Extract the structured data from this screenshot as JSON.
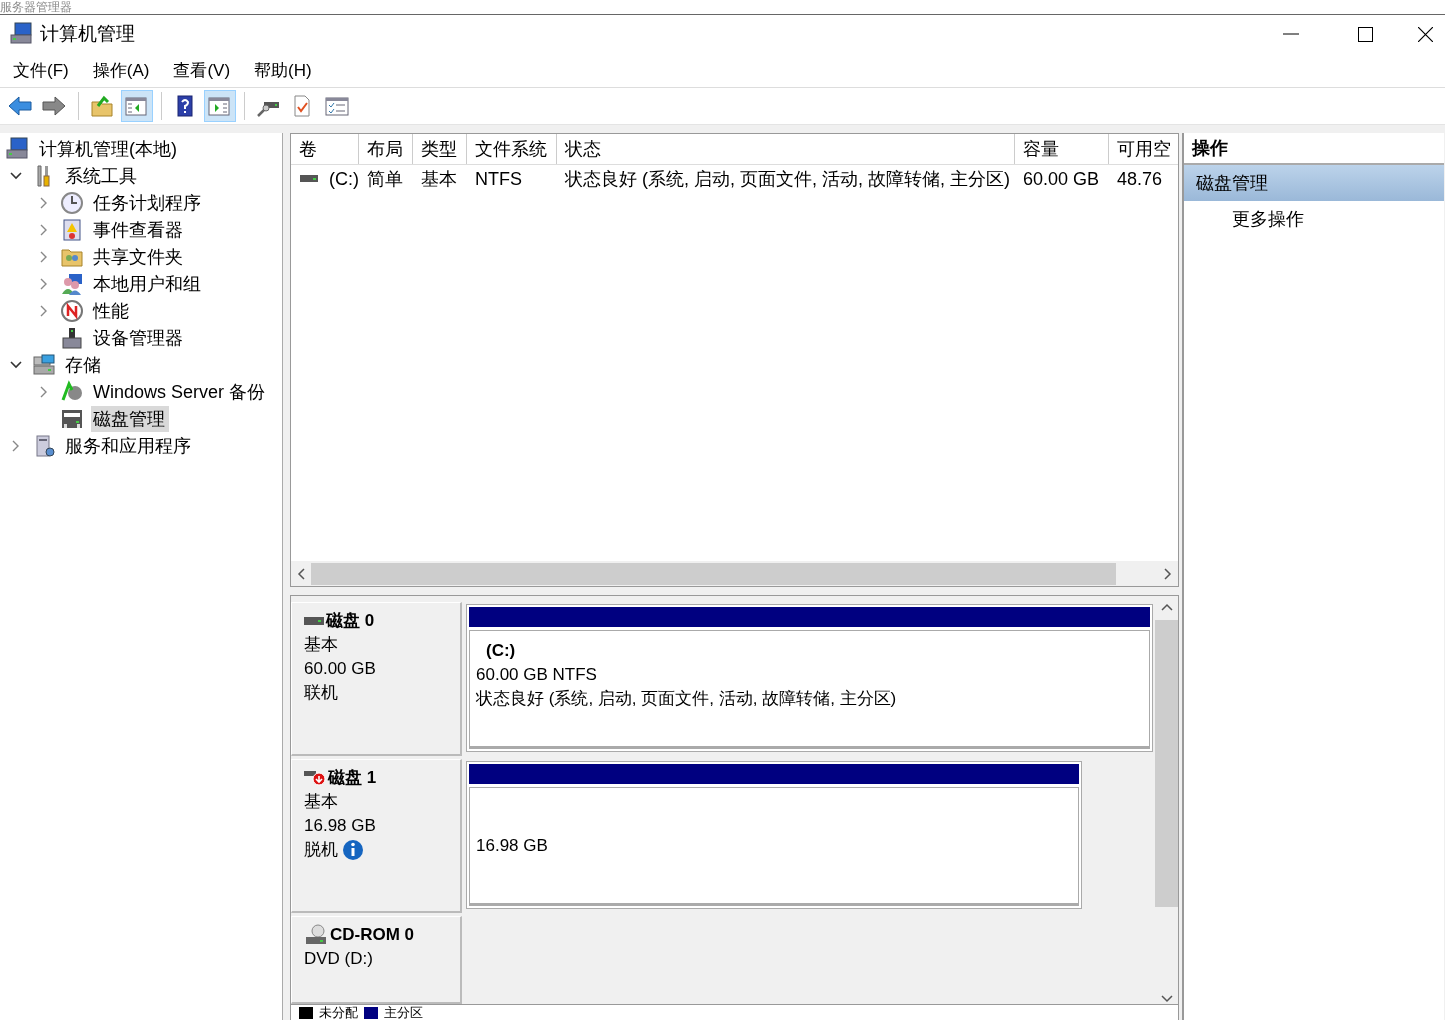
{
  "background_window": {
    "title": "服务器管理器"
  },
  "window": {
    "title": "计算机管理"
  },
  "menu": [
    "文件(F)",
    "操作(A)",
    "查看(V)",
    "帮助(H)"
  ],
  "toolbar": [
    {
      "kind": "back",
      "selected": false
    },
    {
      "kind": "forward",
      "selected": false
    },
    {
      "kind": "up",
      "selected": false
    },
    {
      "kind": "tree",
      "selected": true
    },
    {
      "kind": "help",
      "selected": false
    },
    {
      "kind": "pane",
      "selected": true
    },
    {
      "kind": "connect",
      "selected": false
    },
    {
      "kind": "check",
      "selected": false
    },
    {
      "kind": "list",
      "selected": false
    }
  ],
  "tree": {
    "items": [
      {
        "label": "计算机管理(本地)",
        "kind": "computer",
        "selected": false,
        "children": [
          {
            "label": "系统工具",
            "kind": "tools",
            "expanded": true,
            "selected": false,
            "children": [
              {
                "label": "任务计划程序",
                "kind": "clock",
                "expanded": false,
                "selected": false
              },
              {
                "label": "事件查看器",
                "kind": "log",
                "expanded": false,
                "selected": false
              },
              {
                "label": "共享文件夹",
                "kind": "folder",
                "expanded": false,
                "selected": false
              },
              {
                "label": "本地用户和组",
                "kind": "users",
                "expanded": false,
                "selected": false
              },
              {
                "label": "性能",
                "kind": "gauge",
                "expanded": false,
                "selected": false
              },
              {
                "label": "设备管理器",
                "kind": "device",
                "selected": false
              }
            ]
          },
          {
            "label": "存储",
            "kind": "storage",
            "expanded": true,
            "selected": false,
            "children": [
              {
                "label": "Windows Server 备份",
                "kind": "backup",
                "expanded": false,
                "selected": false
              },
              {
                "label": "磁盘管理",
                "kind": "disk",
                "selected": true
              }
            ]
          },
          {
            "label": "服务和应用程序",
            "kind": "server",
            "expanded": false,
            "selected": false
          }
        ]
      }
    ]
  },
  "volumes_table": {
    "columns": [
      "卷",
      "布局",
      "类型",
      "文件系统",
      "状态",
      "容量",
      "可用空"
    ],
    "rows": [
      {
        "cells": [
          "(C:)",
          "简单",
          "基本",
          "NTFS",
          "状态良好 (系统, 启动, 页面文件, 活动, 故障转储, 主分区)",
          "60.00 GB",
          "48.76"
        ]
      }
    ]
  },
  "disks": [
    {
      "kind": "disk",
      "name": "磁盘 0",
      "type": "基本",
      "size": "60.00 GB",
      "status": "联机",
      "offline": false,
      "partitions": [
        {
          "name": "(C:)",
          "size": "60.00 GB NTFS",
          "status": "状态良好 (系统, 启动, 页面文件, 活动, 故障转储, 主分区)"
        }
      ]
    },
    {
      "kind": "disk",
      "name": "磁盘 1",
      "type": "基本",
      "size": "16.98 GB",
      "status": "脱机",
      "offline": true,
      "partitions": [
        {
          "size": "16.98 GB"
        }
      ]
    },
    {
      "kind": "cdrom",
      "name": "CD-ROM 0",
      "type": "DVD (D:)"
    }
  ],
  "legend": [
    {
      "label": "未分配",
      "color": "#000000"
    },
    {
      "label": "主分区",
      "color": "#000080"
    }
  ],
  "actions": {
    "title": "操作",
    "section": "磁盘管理",
    "items": [
      "更多操作"
    ]
  }
}
